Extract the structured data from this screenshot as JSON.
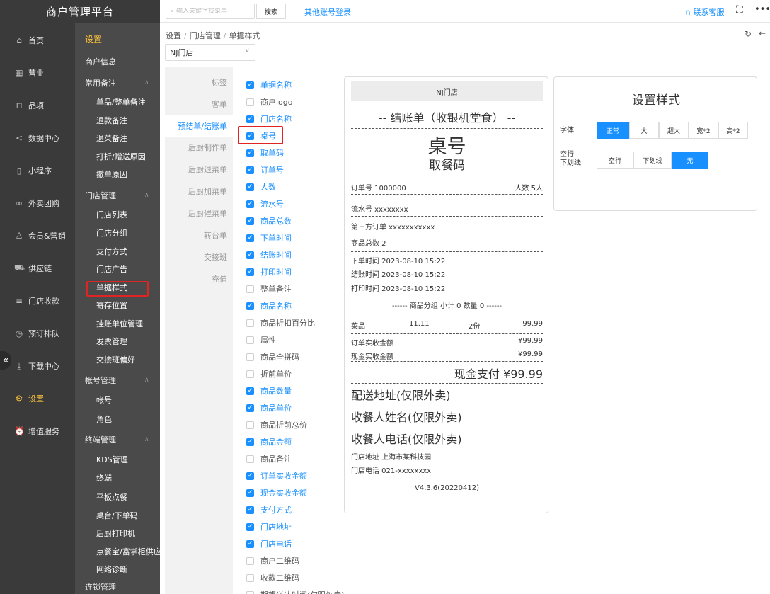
{
  "app": {
    "title": "商户管理平台"
  },
  "topbar": {
    "search_placeholder": "输入关键字找菜单",
    "search_button": "搜索",
    "other_login": "其他账号登录",
    "support": "联系客服",
    "fullscreen_glyph": "⛶",
    "more_glyph": "•••"
  },
  "nav": [
    {
      "label": "首页",
      "icon": "home-icon",
      "glyph": "⌂"
    },
    {
      "label": "营业",
      "icon": "calendar-icon",
      "glyph": "▦"
    },
    {
      "label": "品项",
      "icon": "bag-icon",
      "glyph": "⊓"
    },
    {
      "label": "数据中心",
      "icon": "share-icon",
      "glyph": "<"
    },
    {
      "label": "小程序",
      "icon": "mobile-icon",
      "glyph": "▯"
    },
    {
      "label": "外卖团购",
      "icon": "bike-icon",
      "glyph": "∞"
    },
    {
      "label": "会员&营销",
      "icon": "user-icon",
      "glyph": "♙"
    },
    {
      "label": "供应链",
      "icon": "truck-icon",
      "glyph": "⛟"
    },
    {
      "label": "门店收款",
      "icon": "database-icon",
      "glyph": "≡"
    },
    {
      "label": "预订排队",
      "icon": "clock-icon",
      "glyph": "◷"
    },
    {
      "label": "下载中心",
      "icon": "download-icon",
      "glyph": "⤓"
    },
    {
      "label": "设置",
      "icon": "gear-icon",
      "glyph": "⚙"
    },
    {
      "label": "增值服务",
      "icon": "alarm-icon",
      "glyph": "⏰"
    }
  ],
  "nav_collapse_glyph": "«",
  "submenu": {
    "title": "设置",
    "items": [
      {
        "label": "商户信息",
        "kind": "group"
      },
      {
        "label": "常用备注",
        "kind": "group",
        "arrow": true
      },
      {
        "label": "单品/整单备注",
        "kind": "leaf"
      },
      {
        "label": "退款备注",
        "kind": "leaf"
      },
      {
        "label": "退菜备注",
        "kind": "leaf"
      },
      {
        "label": "打折/赠送原因",
        "kind": "leaf"
      },
      {
        "label": "撤单原因",
        "kind": "leaf"
      },
      {
        "label": "门店管理",
        "kind": "group",
        "arrow": true
      },
      {
        "label": "门店列表",
        "kind": "leaf"
      },
      {
        "label": "门店分组",
        "kind": "leaf"
      },
      {
        "label": "支付方式",
        "kind": "leaf"
      },
      {
        "label": "门店广告",
        "kind": "leaf"
      },
      {
        "label": "单据样式",
        "kind": "leaf",
        "active": true
      },
      {
        "label": "寄存位置",
        "kind": "leaf"
      },
      {
        "label": "挂账单位管理",
        "kind": "leaf"
      },
      {
        "label": "发票管理",
        "kind": "leaf"
      },
      {
        "label": "交接班偏好",
        "kind": "leaf"
      },
      {
        "label": "帐号管理",
        "kind": "group",
        "arrow": true
      },
      {
        "label": "帐号",
        "kind": "leaf"
      },
      {
        "label": "角色",
        "kind": "leaf"
      },
      {
        "label": "终端管理",
        "kind": "group",
        "arrow": true
      },
      {
        "label": "KDS管理",
        "kind": "leaf"
      },
      {
        "label": "终端",
        "kind": "leaf"
      },
      {
        "label": "平板点餐",
        "kind": "leaf"
      },
      {
        "label": "桌台/下单码",
        "kind": "leaf"
      },
      {
        "label": "后厨打印机",
        "kind": "leaf"
      },
      {
        "label": "点餐宝/富掌柜供应",
        "kind": "leaf"
      },
      {
        "label": "网络诊断",
        "kind": "leaf"
      },
      {
        "label": "连锁管理",
        "kind": "group"
      }
    ]
  },
  "breadcrumb": [
    "设置",
    "门店管理",
    "单据样式"
  ],
  "store_select": {
    "value": "NJ门店"
  },
  "tabs": [
    {
      "label": "标签"
    },
    {
      "label": "客单"
    },
    {
      "label": "预结单/结账单",
      "active": true
    },
    {
      "label": "后厨制作单"
    },
    {
      "label": "后厨退菜单"
    },
    {
      "label": "后厨加菜单"
    },
    {
      "label": "后厨催菜单"
    },
    {
      "label": "转台单"
    },
    {
      "label": "交接班"
    },
    {
      "label": "充值"
    }
  ],
  "checkboxes": [
    {
      "label": "单据名称",
      "checked": true
    },
    {
      "label": "商户logo",
      "checked": false
    },
    {
      "label": "门店名称",
      "checked": true
    },
    {
      "label": "桌号",
      "checked": true
    },
    {
      "label": "取单码",
      "checked": true
    },
    {
      "label": "订单号",
      "checked": true
    },
    {
      "label": "人数",
      "checked": true
    },
    {
      "label": "流水号",
      "checked": true
    },
    {
      "label": "商品总数",
      "checked": true
    },
    {
      "label": "下单时间",
      "checked": true
    },
    {
      "label": "结账时间",
      "checked": true
    },
    {
      "label": "打印时间",
      "checked": true
    },
    {
      "label": "整单备注",
      "checked": false
    },
    {
      "label": "商品名称",
      "checked": true
    },
    {
      "label": "商品折扣百分比",
      "checked": false
    },
    {
      "label": "属性",
      "checked": false
    },
    {
      "label": "商品全拼码",
      "checked": false
    },
    {
      "label": "折前单价",
      "checked": false
    },
    {
      "label": "商品数量",
      "checked": true
    },
    {
      "label": "商品单价",
      "checked": true
    },
    {
      "label": "商品折前总价",
      "checked": false
    },
    {
      "label": "商品金额",
      "checked": true
    },
    {
      "label": "商品备注",
      "checked": false
    },
    {
      "label": "订单实收金额",
      "checked": true
    },
    {
      "label": "现金实收金额",
      "checked": true
    },
    {
      "label": "支付方式",
      "checked": true
    },
    {
      "label": "门店地址",
      "checked": true
    },
    {
      "label": "门店电话",
      "checked": true
    },
    {
      "label": "商户二维码",
      "checked": false
    },
    {
      "label": "收款二维码",
      "checked": false
    },
    {
      "label": "期望送达时间(仅限外卖)",
      "checked": false
    }
  ],
  "receipt": {
    "store_name": "NJ门店",
    "doc_title": "-- 结账单（收银机堂食） --",
    "table_no": "桌号",
    "pickup_code": "取餐码",
    "order_no": "订单号 1000000",
    "guests": "人数 5人",
    "serial_no": "流水号 xxxxxxxx",
    "third_party": "第三方订单 xxxxxxxxxxx",
    "item_total": "商品总数 2",
    "order_time": "下单时间 2023-08-10 15:22",
    "checkout_time": "结账时间 2023-08-10 15:22",
    "print_time": "打印时间 2023-08-10 15:22",
    "group_line": "------ 商品分组 小计 0 数量 0 ------",
    "item": {
      "name": "菜品",
      "price": "11.11",
      "qty": "2份",
      "amount": "99.99"
    },
    "order_paid_label": "订单实收金额",
    "order_paid_value": "¥99.99",
    "cash_paid_label": "现金实收金额",
    "cash_paid_value": "¥99.99",
    "payment": "现金支付 ¥99.99",
    "delivery_address": "配送地址(仅限外卖)",
    "receiver_name": "收餐人姓名(仅限外卖)",
    "receiver_phone": "收餐人电话(仅限外卖)",
    "store_address": "门店地址 上海市某科技园",
    "store_phone": "门店电话 021-xxxxxxxx",
    "version": "V4.3.6(20220412)"
  },
  "style_panel": {
    "title": "设置样式",
    "font_label": "字体",
    "font_options": [
      {
        "label": "正常",
        "selected": true
      },
      {
        "label": "大",
        "selected": false
      },
      {
        "label": "超大",
        "selected": false
      },
      {
        "label": "宽*2",
        "selected": false
      },
      {
        "label": "高*2",
        "selected": false
      }
    ],
    "blank_label_1": "空行",
    "blank_label_2": "下划线",
    "blank_options": [
      {
        "label": "空行",
        "selected": false
      },
      {
        "label": "下划线",
        "selected": false
      },
      {
        "label": "无",
        "selected": true
      }
    ]
  },
  "colors": {
    "accent": "#1890ff",
    "sidebar": "#3a3a3a",
    "submenu": "#4a4a4a",
    "active_menu": "#ffc53d",
    "highlight": "#e02424"
  }
}
